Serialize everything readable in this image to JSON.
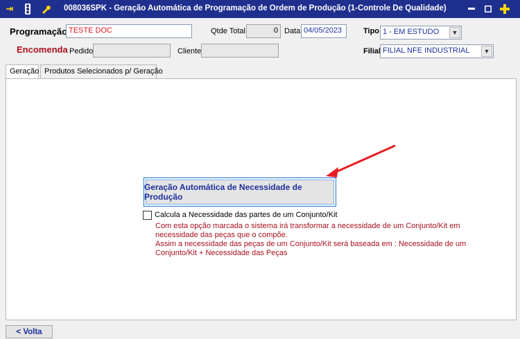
{
  "window": {
    "title": "008036SPK - Geração Automática de Programação de Ordem de Produção (1-Controle De Qualidade)"
  },
  "header": {
    "programacao_label": "Programação",
    "programacao_value": "TESTE DOC",
    "qtde_total_label": "Qtde Total",
    "qtde_total_value": "0",
    "data_label": "Data",
    "data_value": "04/05/2023",
    "tipo_label": "Tipo",
    "tipo_value": "1 - EM ESTUDO",
    "encomenda_label": "Encomenda",
    "pedido_label": "Pedido",
    "pedido_value": "",
    "cliente_label": "Cliente",
    "cliente_value": "",
    "filial_label": "Filial",
    "filial_value": "FILIAL NFE INDUSTRIAL"
  },
  "tabs": [
    {
      "label": "Geração"
    },
    {
      "label": "Produtos Selecionados p/ Geração"
    }
  ],
  "main": {
    "generate_button": "Geração Automática  de Necessidade de Produção",
    "checkbox_label": "Calcula a Necessidade das partes de um Conjunto/Kit",
    "checkbox_checked": false,
    "note_lines": [
      "Com esta opção marcada o sistema irá transformar a necessidade de um Conjunto/Kit em",
      "necessidade das peças que o compõe.",
      "Assim a necessidade das peças de um Conjunto/Kit será baseada em : Necessidade de um",
      "Conjunto/Kit + Necessidade das Peças"
    ]
  },
  "footer": {
    "back_button": "< Volta"
  },
  "colors": {
    "titlebar": "#1f2f8e",
    "accent_red": "#a8101e",
    "field_text_blue": "#1c2f9c",
    "annotation_arrow": "#e31e24"
  }
}
